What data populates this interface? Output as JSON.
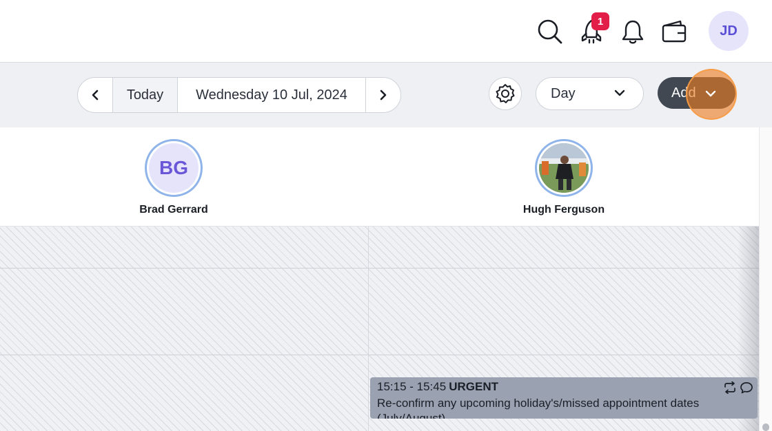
{
  "header": {
    "notification_badge": "1",
    "user_initials": "JD",
    "icons": [
      "search-icon",
      "rocket-icon",
      "bell-icon",
      "wallet-icon"
    ]
  },
  "toolbar": {
    "today_label": "Today",
    "current_date": "Wednesday 10 Jul, 2024",
    "view_value": "Day",
    "add_label": "Add"
  },
  "staff": [
    {
      "initials": "BG",
      "name": "Brad Gerrard"
    },
    {
      "initials": "",
      "name": "Hugh Ferguson"
    }
  ],
  "event": {
    "time": "15:15 - 15:45",
    "title": "URGENT",
    "description": "Re-confirm any upcoming holiday's/missed appointment dates (July/August)"
  },
  "colors": {
    "accent": "#5b4fd6",
    "badge": "#e11d48",
    "add_button": "#414852",
    "event_bg": "#9aa2b2"
  }
}
